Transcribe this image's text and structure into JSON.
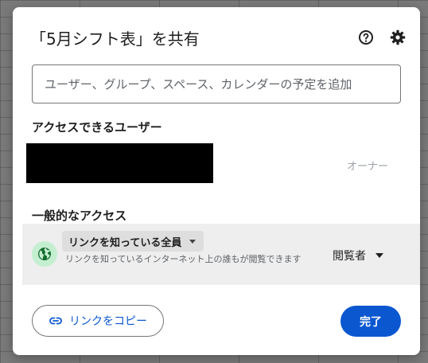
{
  "dialog": {
    "title": "「5月シフト表」を共有",
    "icons": {
      "help": "help-circle-icon",
      "settings": "gear-icon"
    }
  },
  "search": {
    "placeholder": "ユーザー、グループ、スペース、カレンダーの予定を追加",
    "value": ""
  },
  "people": {
    "section_title": "アクセスできるユーザー",
    "owner_role": "オーナー"
  },
  "general_access": {
    "section_title": "一般的なアクセス",
    "link_setting": "リンクを知っている全員",
    "description": "リンクを知っているインターネット上の誰もが閲覧できます",
    "role": "閲覧者",
    "icon": "globe-icon"
  },
  "footer": {
    "copy_link_label": "リンクをコピー",
    "copy_link_icon": "link-icon",
    "done_label": "完了"
  },
  "colors": {
    "accent": "#0b57d0",
    "globe_bg": "#c4eed0",
    "row_bg": "#eeeeee"
  }
}
